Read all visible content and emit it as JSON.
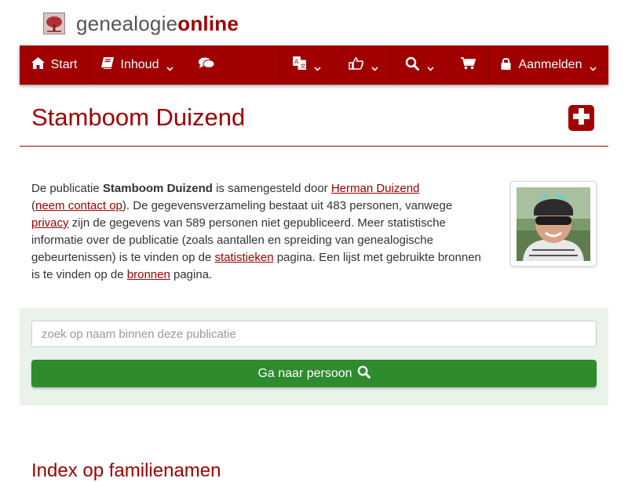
{
  "brand": {
    "part1": "genealogie",
    "part2": "online"
  },
  "nav": {
    "start": "Start",
    "inhoud": "Inhoud",
    "aanmelden": "Aanmelden"
  },
  "page": {
    "title": "Stamboom Duizend"
  },
  "intro": {
    "t1": "De publicatie ",
    "pub_name": "Stamboom Duizend",
    "t2": " is samengesteld door ",
    "author_link": "Herman Duizend",
    "t3": "(",
    "contact_link": "neem contact op",
    "t4": "). De gegevensverzameling bestaat uit 483 personen, vanwege ",
    "privacy_link": "privacy",
    "t5": " zijn de gegevens van 589 personen niet gepubliceerd. Meer statistische informatie over de publicatie (zoals aantallen en spreiding van genealogische gebeurtenissen) is te vinden op de ",
    "stats_link": "statistieken",
    "t6": " pagina. Een lijst met gebruikte bronnen is te vinden op de ",
    "sources_link": "bronnen",
    "t7": " pagina."
  },
  "search": {
    "placeholder": "zoek op naam binnen deze publicatie",
    "button_label": "Ga naar persoon"
  },
  "sections": {
    "index_title": "Index op familienamen"
  },
  "colors": {
    "brand": "#a00000",
    "button_green": "#2e8b2e",
    "panel_bg": "#e9f3e9"
  }
}
